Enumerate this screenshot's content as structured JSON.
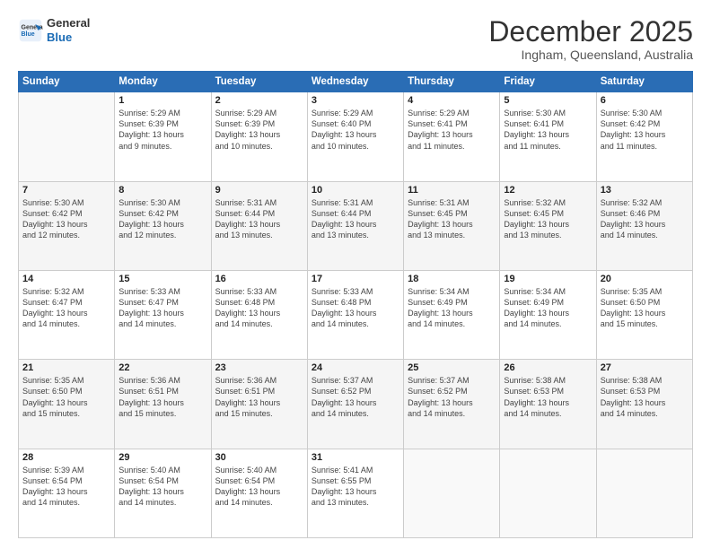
{
  "logo": {
    "line1": "General",
    "line2": "Blue"
  },
  "header": {
    "month": "December 2025",
    "location": "Ingham, Queensland, Australia"
  },
  "weekdays": [
    "Sunday",
    "Monday",
    "Tuesday",
    "Wednesday",
    "Thursday",
    "Friday",
    "Saturday"
  ],
  "weeks": [
    [
      {
        "day": "",
        "info": ""
      },
      {
        "day": "1",
        "info": "Sunrise: 5:29 AM\nSunset: 6:39 PM\nDaylight: 13 hours\nand 9 minutes."
      },
      {
        "day": "2",
        "info": "Sunrise: 5:29 AM\nSunset: 6:39 PM\nDaylight: 13 hours\nand 10 minutes."
      },
      {
        "day": "3",
        "info": "Sunrise: 5:29 AM\nSunset: 6:40 PM\nDaylight: 13 hours\nand 10 minutes."
      },
      {
        "day": "4",
        "info": "Sunrise: 5:29 AM\nSunset: 6:41 PM\nDaylight: 13 hours\nand 11 minutes."
      },
      {
        "day": "5",
        "info": "Sunrise: 5:30 AM\nSunset: 6:41 PM\nDaylight: 13 hours\nand 11 minutes."
      },
      {
        "day": "6",
        "info": "Sunrise: 5:30 AM\nSunset: 6:42 PM\nDaylight: 13 hours\nand 11 minutes."
      }
    ],
    [
      {
        "day": "7",
        "info": "Sunrise: 5:30 AM\nSunset: 6:42 PM\nDaylight: 13 hours\nand 12 minutes."
      },
      {
        "day": "8",
        "info": "Sunrise: 5:30 AM\nSunset: 6:42 PM\nDaylight: 13 hours\nand 12 minutes."
      },
      {
        "day": "9",
        "info": "Sunrise: 5:31 AM\nSunset: 6:44 PM\nDaylight: 13 hours\nand 13 minutes."
      },
      {
        "day": "10",
        "info": "Sunrise: 5:31 AM\nSunset: 6:44 PM\nDaylight: 13 hours\nand 13 minutes."
      },
      {
        "day": "11",
        "info": "Sunrise: 5:31 AM\nSunset: 6:45 PM\nDaylight: 13 hours\nand 13 minutes."
      },
      {
        "day": "12",
        "info": "Sunrise: 5:32 AM\nSunset: 6:45 PM\nDaylight: 13 hours\nand 13 minutes."
      },
      {
        "day": "13",
        "info": "Sunrise: 5:32 AM\nSunset: 6:46 PM\nDaylight: 13 hours\nand 14 minutes."
      }
    ],
    [
      {
        "day": "14",
        "info": "Sunrise: 5:32 AM\nSunset: 6:47 PM\nDaylight: 13 hours\nand 14 minutes."
      },
      {
        "day": "15",
        "info": "Sunrise: 5:33 AM\nSunset: 6:47 PM\nDaylight: 13 hours\nand 14 minutes."
      },
      {
        "day": "16",
        "info": "Sunrise: 5:33 AM\nSunset: 6:48 PM\nDaylight: 13 hours\nand 14 minutes."
      },
      {
        "day": "17",
        "info": "Sunrise: 5:33 AM\nSunset: 6:48 PM\nDaylight: 13 hours\nand 14 minutes."
      },
      {
        "day": "18",
        "info": "Sunrise: 5:34 AM\nSunset: 6:49 PM\nDaylight: 13 hours\nand 14 minutes."
      },
      {
        "day": "19",
        "info": "Sunrise: 5:34 AM\nSunset: 6:49 PM\nDaylight: 13 hours\nand 14 minutes."
      },
      {
        "day": "20",
        "info": "Sunrise: 5:35 AM\nSunset: 6:50 PM\nDaylight: 13 hours\nand 15 minutes."
      }
    ],
    [
      {
        "day": "21",
        "info": "Sunrise: 5:35 AM\nSunset: 6:50 PM\nDaylight: 13 hours\nand 15 minutes."
      },
      {
        "day": "22",
        "info": "Sunrise: 5:36 AM\nSunset: 6:51 PM\nDaylight: 13 hours\nand 15 minutes."
      },
      {
        "day": "23",
        "info": "Sunrise: 5:36 AM\nSunset: 6:51 PM\nDaylight: 13 hours\nand 15 minutes."
      },
      {
        "day": "24",
        "info": "Sunrise: 5:37 AM\nSunset: 6:52 PM\nDaylight: 13 hours\nand 14 minutes."
      },
      {
        "day": "25",
        "info": "Sunrise: 5:37 AM\nSunset: 6:52 PM\nDaylight: 13 hours\nand 14 minutes."
      },
      {
        "day": "26",
        "info": "Sunrise: 5:38 AM\nSunset: 6:53 PM\nDaylight: 13 hours\nand 14 minutes."
      },
      {
        "day": "27",
        "info": "Sunrise: 5:38 AM\nSunset: 6:53 PM\nDaylight: 13 hours\nand 14 minutes."
      }
    ],
    [
      {
        "day": "28",
        "info": "Sunrise: 5:39 AM\nSunset: 6:54 PM\nDaylight: 13 hours\nand 14 minutes."
      },
      {
        "day": "29",
        "info": "Sunrise: 5:40 AM\nSunset: 6:54 PM\nDaylight: 13 hours\nand 14 minutes."
      },
      {
        "day": "30",
        "info": "Sunrise: 5:40 AM\nSunset: 6:54 PM\nDaylight: 13 hours\nand 14 minutes."
      },
      {
        "day": "31",
        "info": "Sunrise: 5:41 AM\nSunset: 6:55 PM\nDaylight: 13 hours\nand 13 minutes."
      },
      {
        "day": "",
        "info": ""
      },
      {
        "day": "",
        "info": ""
      },
      {
        "day": "",
        "info": ""
      }
    ]
  ]
}
